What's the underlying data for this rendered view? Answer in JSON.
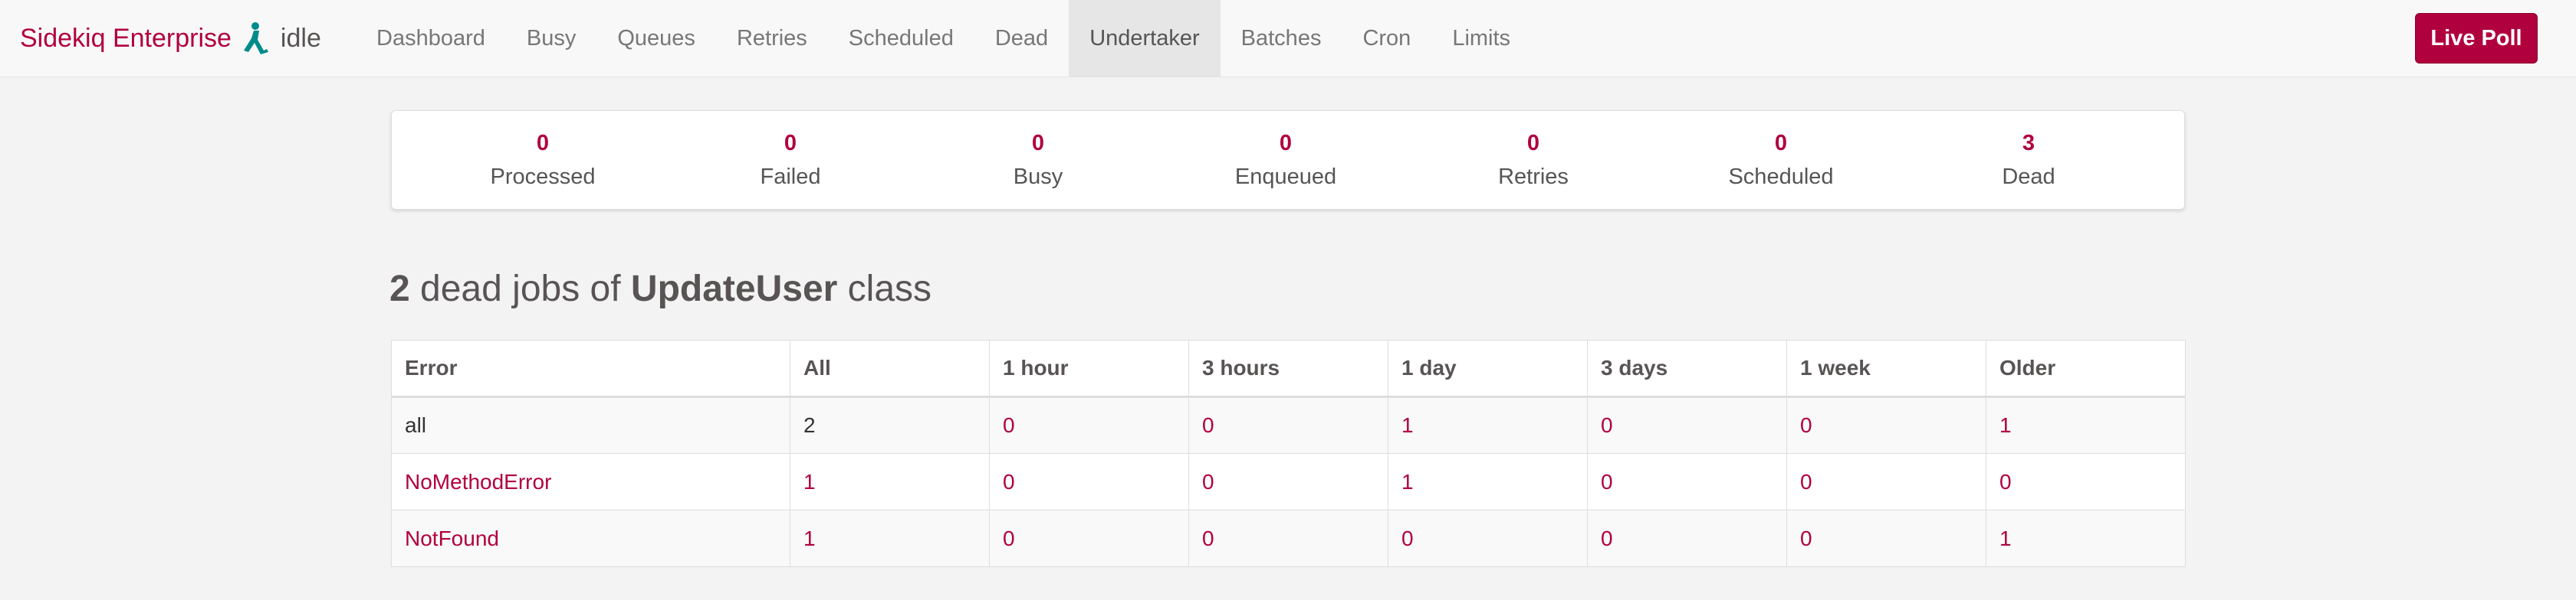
{
  "brand": {
    "name": "Sidekiq Enterprise",
    "status": "idle",
    "logo_icon": "sidekiq-kick-icon"
  },
  "nav": {
    "items": [
      "Dashboard",
      "Busy",
      "Queues",
      "Retries",
      "Scheduled",
      "Dead",
      "Undertaker",
      "Batches",
      "Cron",
      "Limits"
    ],
    "active": "Undertaker"
  },
  "live_poll_label": "Live Poll",
  "summary": [
    {
      "count": "0",
      "label": "Processed"
    },
    {
      "count": "0",
      "label": "Failed"
    },
    {
      "count": "0",
      "label": "Busy"
    },
    {
      "count": "0",
      "label": "Enqueued"
    },
    {
      "count": "0",
      "label": "Retries"
    },
    {
      "count": "0",
      "label": "Scheduled"
    },
    {
      "count": "3",
      "label": "Dead"
    }
  ],
  "heading": {
    "count": "2",
    "pre": " dead jobs of ",
    "job_class": "UpdateUser",
    "post": " class"
  },
  "table": {
    "headers": [
      "Error",
      "All",
      "1 hour",
      "3 hours",
      "1 day",
      "3 days",
      "1 week",
      "Older"
    ],
    "rows": [
      [
        "all",
        "2",
        "0",
        "0",
        "1",
        "0",
        "0",
        "1"
      ],
      [
        "NoMethodError",
        "1",
        "0",
        "0",
        "1",
        "0",
        "0",
        "0"
      ],
      [
        "NotFound",
        "1",
        "0",
        "0",
        "0",
        "0",
        "0",
        "1"
      ]
    ]
  },
  "colors": {
    "accent": "#b1003e",
    "logo": "#008b8b",
    "text": "#585454"
  }
}
